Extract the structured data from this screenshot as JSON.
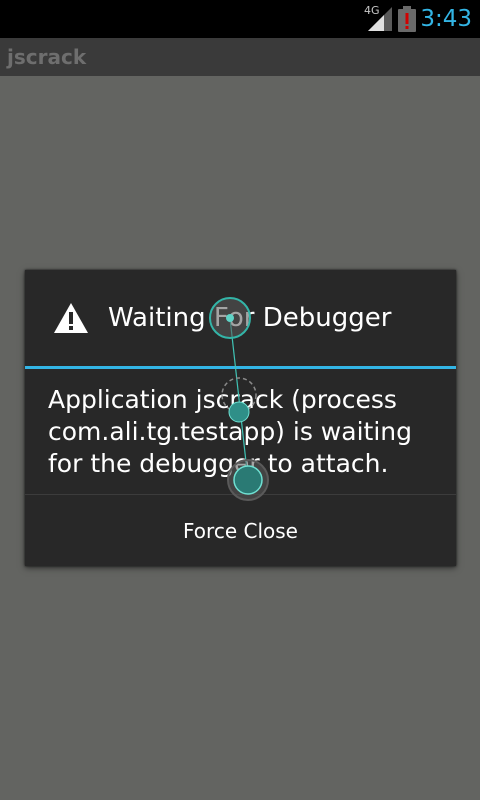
{
  "status_bar": {
    "network_type": "4G",
    "time": "3:43",
    "time_color": "#33b5e5",
    "icons": [
      "signal-icon",
      "battery-alert-icon"
    ]
  },
  "app": {
    "title": "jscrack"
  },
  "dialog": {
    "icon": "warning-icon",
    "title": "Waiting For Debugger",
    "accent_color": "#33b5e5",
    "message": "Application jscrack (process com.ali.tg.testapp) is waiting for the debugger to attach.",
    "button_label": "Force Close"
  },
  "overlay": {
    "icons": [
      "touch-point-icon",
      "touch-trail-icon",
      "touch-point-icon"
    ]
  }
}
